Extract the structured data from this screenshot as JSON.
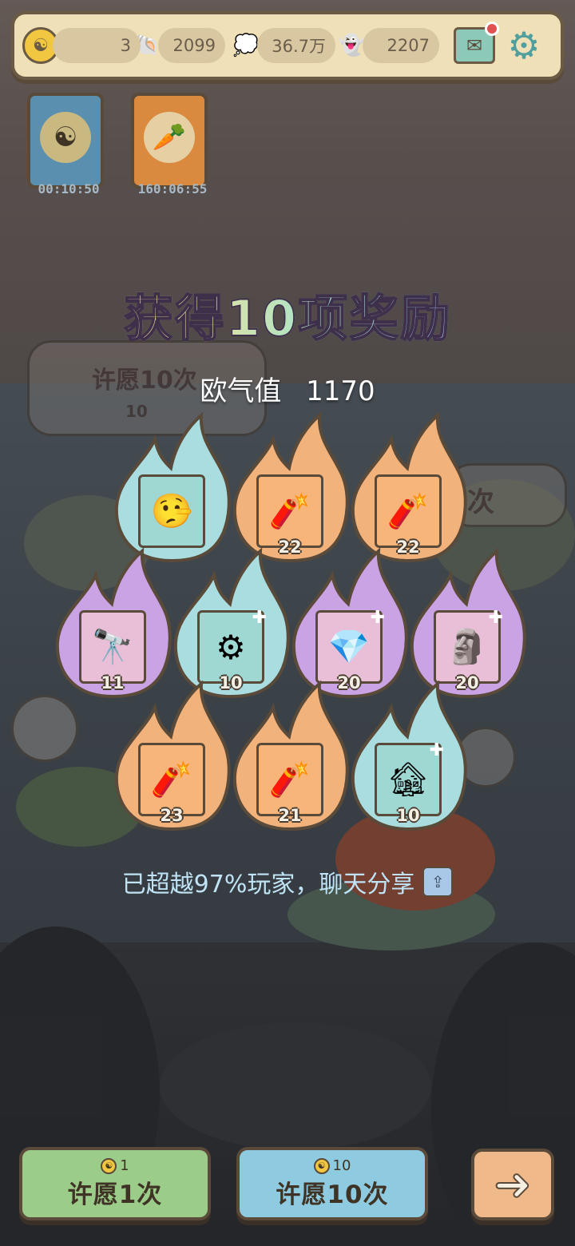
{
  "topbar": {
    "currency_symbol": "☯",
    "coin_count": "3",
    "shell_count": "2099",
    "spirit_count": "36.7万",
    "ghost_count": "2207",
    "mail_icon": "mail-icon",
    "settings_icon": "gear-icon"
  },
  "buffs": [
    {
      "icon": "yin-yang-coin-icon",
      "timer": "00:10:50",
      "color": "#5b8fb0"
    },
    {
      "icon": "vegetable-bundle-icon",
      "timer": "160:06:55",
      "color": "#d98a3f"
    }
  ],
  "behind": {
    "sign_text": "许愿10次",
    "sign_cost": "10",
    "sign_right_text": "次"
  },
  "result": {
    "title": "获得10项奖励",
    "luck_label": "欧气值",
    "luck_value": "1170"
  },
  "rewards": [
    {
      "flame": "blue",
      "icon": "pinocchio-puppet-icon",
      "count": ""
    },
    {
      "flame": "orange",
      "icon": "firecracker-launcher-icon",
      "count": "22"
    },
    {
      "flame": "orange",
      "icon": "firecracker-launcher-icon",
      "count": "22"
    },
    {
      "flame": "purple",
      "icon": "telescope-icon",
      "count": "11"
    },
    {
      "flame": "blue",
      "icon": "bronze-orb-icon",
      "count": "10"
    },
    {
      "flame": "purple",
      "icon": "pendant-icon",
      "count": "20"
    },
    {
      "flame": "purple",
      "icon": "cherub-statue-icon",
      "count": "20"
    },
    {
      "flame": "orange",
      "icon": "firecracker-launcher-icon",
      "count": "23"
    },
    {
      "flame": "orange",
      "icon": "firecracker-launcher-icon",
      "count": "21"
    },
    {
      "flame": "blue",
      "icon": "stilt-house-icon",
      "count": "10"
    }
  ],
  "share": {
    "text": "已超越97%玩家，聊天分享",
    "icon": "share-icon"
  },
  "buttons": {
    "wish_once_cost": "1",
    "wish_once_label": "许愿1次",
    "wish_ten_cost": "10",
    "wish_ten_label": "许愿10次",
    "next_icon": "arrow-right-icon"
  },
  "colors": {
    "flame_blue": "#a9dde0",
    "flame_orange": "#f2b27c",
    "flame_purple": "#c9a3e3",
    "card_blue": "#9fd7d3",
    "card_orange": "#f8b57a",
    "card_purple": "#e9bfd8",
    "wish_once_bg": "#9ccc8a",
    "wish_ten_bg": "#8ecbe0"
  }
}
